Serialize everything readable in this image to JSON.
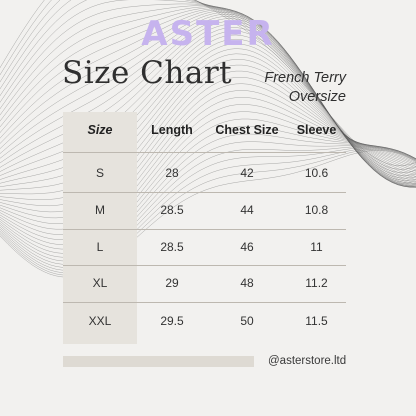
{
  "brand": {
    "name": "ASTER",
    "color": "#c6b3ee"
  },
  "title": "Size Chart",
  "subtitle": {
    "line1": "French Terry",
    "line2": "Oversize"
  },
  "table": {
    "headers": [
      "Size",
      "Length",
      "Chest Size",
      "Sleeve"
    ],
    "rows": [
      [
        "S",
        "28",
        "42",
        "10.6"
      ],
      [
        "M",
        "28.5",
        "44",
        "10.8"
      ],
      [
        "L",
        "28.5",
        "46",
        "11"
      ],
      [
        "XL",
        "29",
        "48",
        "11.2"
      ],
      [
        "XXL",
        "29.5",
        "50",
        "11.5"
      ]
    ]
  },
  "footer": {
    "handle": "@asterstore.ltd"
  },
  "colors": {
    "background": "#f2f1ef",
    "first_column": "#e6e3dd",
    "text": "#2f2f2f"
  }
}
